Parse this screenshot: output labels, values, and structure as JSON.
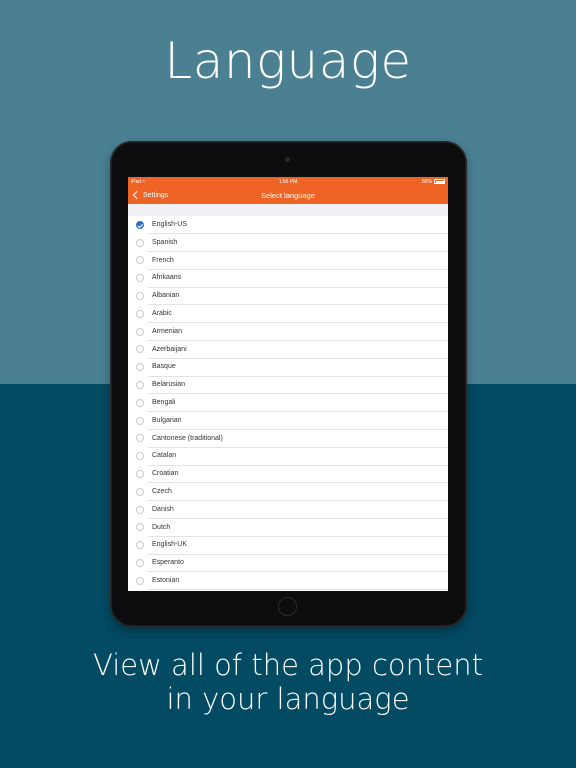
{
  "promo": {
    "headline": "Language",
    "caption_line1": "View all of the app content",
    "caption_line2": "in your language"
  },
  "colors": {
    "background_top": "#4b8093",
    "background_bottom": "#034a63",
    "accent_orange": "#ef6424",
    "check_blue": "#2e6fcf"
  },
  "status_bar": {
    "device": "iPad",
    "wifi_icon": "wifi-icon",
    "time": "1:56 PM",
    "battery": "86%"
  },
  "nav": {
    "back_label": "Settings",
    "title": "Select language"
  },
  "languages": [
    {
      "label": "English-US",
      "selected": true
    },
    {
      "label": "Spanish",
      "selected": false
    },
    {
      "label": "French",
      "selected": false
    },
    {
      "label": "Afrikaans",
      "selected": false
    },
    {
      "label": "Albanian",
      "selected": false
    },
    {
      "label": "Arabic",
      "selected": false
    },
    {
      "label": "Armenian",
      "selected": false
    },
    {
      "label": "Azerbaijani",
      "selected": false
    },
    {
      "label": "Basque",
      "selected": false
    },
    {
      "label": "Belarusian",
      "selected": false
    },
    {
      "label": "Bengali",
      "selected": false
    },
    {
      "label": "Bulgarian",
      "selected": false
    },
    {
      "label": "Cantonese (traditional)",
      "selected": false
    },
    {
      "label": "Catalan",
      "selected": false
    },
    {
      "label": "Croatian",
      "selected": false
    },
    {
      "label": "Czech",
      "selected": false
    },
    {
      "label": "Danish",
      "selected": false
    },
    {
      "label": "Dutch",
      "selected": false
    },
    {
      "label": "English-UK",
      "selected": false
    },
    {
      "label": "Esperanto",
      "selected": false
    },
    {
      "label": "Estonian",
      "selected": false
    }
  ]
}
